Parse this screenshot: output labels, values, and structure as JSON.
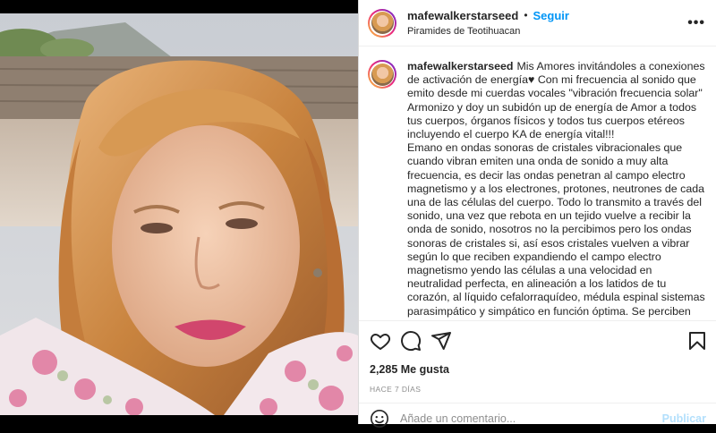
{
  "post": {
    "username": "mafewalkerstarseed",
    "dot": "•",
    "follow_label": "Seguir",
    "location": "Piramides de Teotihuacan",
    "more_label": "•••"
  },
  "caption": {
    "username": "mafewalkerstarseed",
    "paragraphs": [
      "Mis Amores invitándoles a conexiones de activación de energía♥ Con mi frecuencia al sonido que emito desde mi cuerdas vocales \"vibración frecuencia solar\" Armonizo y doy un subidón up de energía de Amor a todos tus cuerpos, órganos físicos y todos tus cuerpos etéreos incluyendo el cuerpo KA de energía vital!!!",
      "Emano en ondas sonoras de cristales vibracionales que cuando vibran emiten una onda de sonido a muy alta frecuencia, es decir las ondas penetran al campo electro magnetismo y a los electrones, protones, neutrones de cada una de las células del cuerpo. Todo lo transmito a través del sonido, una vez que rebota en un tejido vuelve a recibir la onda de sonido, nosotros no la percibimos pero los ondas sonoras de cristales si, así esos cristales vuelven a vibrar según lo que reciben expandiendo el campo electro magnetismo yendo las células a una velocidad en neutralidad perfecta, en alineación a los latidos de tu corazón, al líquido cefalorraquídeo, médula espinal sistemas parasimpático y simpático en función óptima. Se perciben vibraciones y el cuerpo manifiesta una realidad a una sensación de estado vital y en balance perfecto. Extrema vitalidad. La sangre se limpia y fluye"
    ]
  },
  "stats": {
    "likes": "2,285 Me gusta",
    "time": "HACE 7 DÍAS"
  },
  "comment": {
    "placeholder": "Añade un comentario...",
    "publish_label": "Publicar"
  },
  "icons": {
    "like": "heart-icon",
    "comment": "comment-icon",
    "share": "share-icon",
    "save": "bookmark-icon",
    "emoji": "emoji-icon",
    "more": "more-icon"
  },
  "colors": {
    "accent": "#0095f6",
    "publish_disabled": "#b2dffc",
    "muted": "#8e8e8e"
  }
}
